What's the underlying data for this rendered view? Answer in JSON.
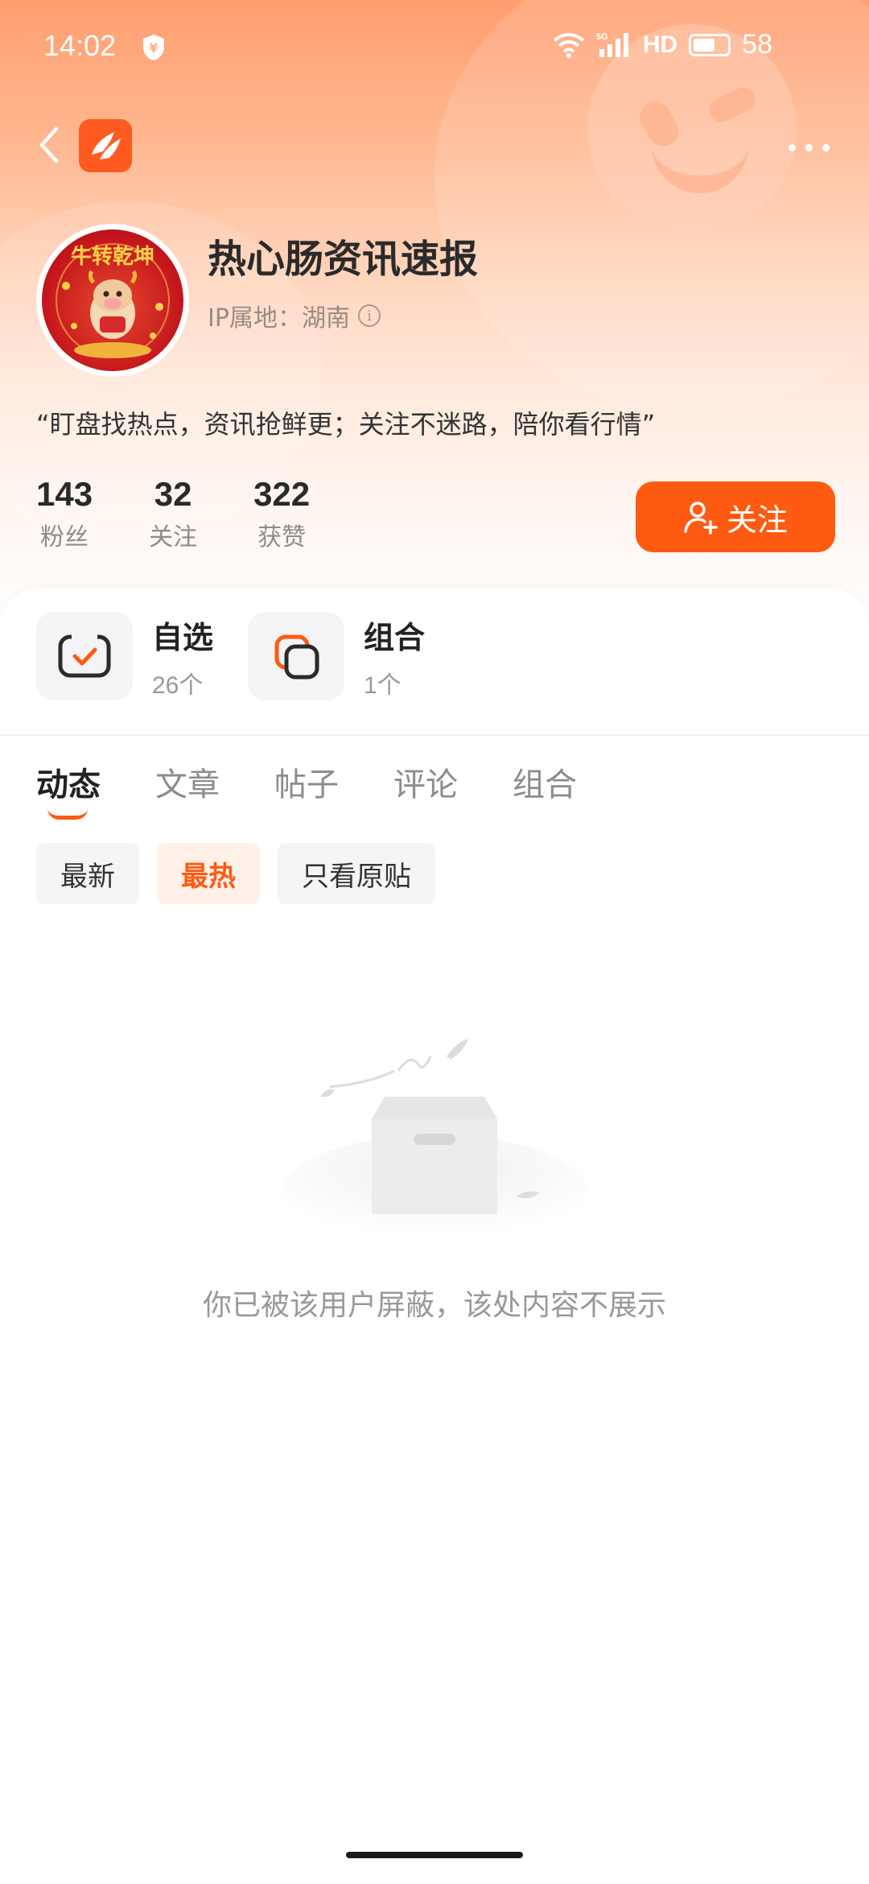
{
  "status_bar": {
    "time": "14:02",
    "network": "5G",
    "hd": "HD",
    "battery": "58"
  },
  "profile": {
    "name": "热心肠资讯速报",
    "ip_location": "IP属地：湖南",
    "bio": "“盯盘找热点，资讯抢鲜更；关注不迷路，陪你看行情”",
    "avatar_text": "牛转乾坤",
    "stats": [
      {
        "value": "143",
        "label": "粉丝"
      },
      {
        "value": "32",
        "label": "关注"
      },
      {
        "value": "322",
        "label": "获赞"
      }
    ],
    "follow_label": "关注"
  },
  "quick_entries": [
    {
      "title": "自选",
      "count": "26个"
    },
    {
      "title": "组合",
      "count": "1个"
    }
  ],
  "tabs": [
    "动态",
    "文章",
    "帖子",
    "评论",
    "组合"
  ],
  "active_tab": "动态",
  "filters": [
    "最新",
    "最热",
    "只看原贴"
  ],
  "active_filter": "最热",
  "empty_message": "你已被该用户屏蔽，该处内容不展示",
  "colors": {
    "accent": "#ff5a12",
    "header_top": "#ff9e6f"
  }
}
